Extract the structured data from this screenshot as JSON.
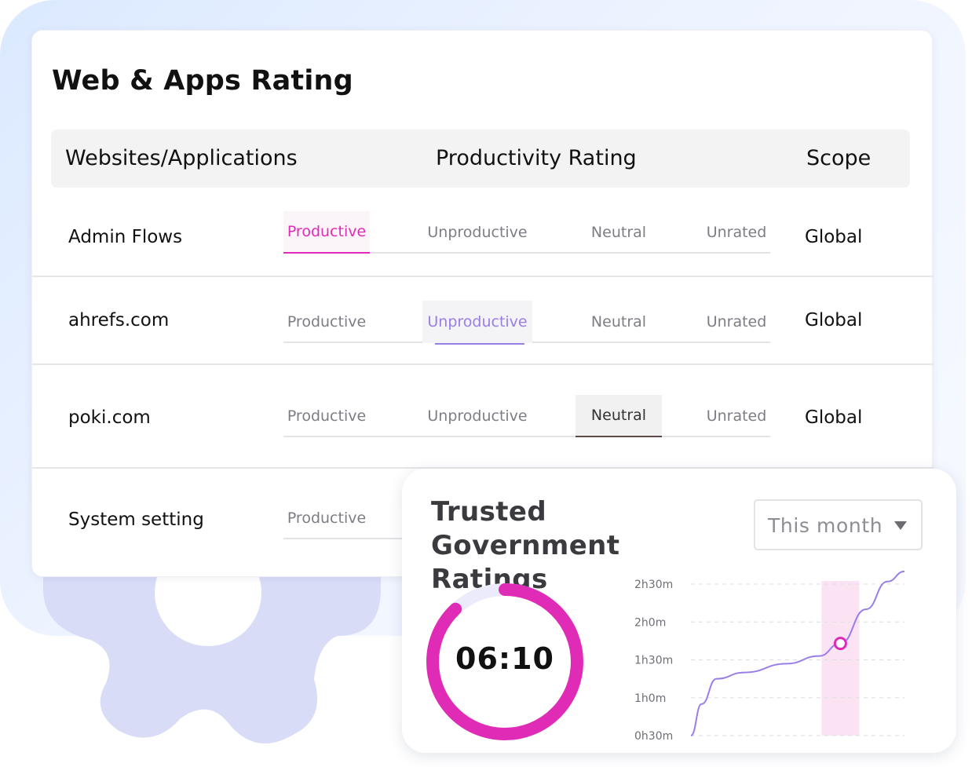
{
  "rating_card": {
    "title": "Web & Apps Rating",
    "columns": {
      "sites": "Websites/Applications",
      "rating": "Productivity Rating",
      "scope": "Scope"
    },
    "rating_options": [
      "Productive",
      "Unproductive",
      "Neutral",
      "Unrated"
    ],
    "rows": [
      {
        "name": "Admin Flows",
        "selected": "Productive",
        "scope": "Global"
      },
      {
        "name": "ahrefs.com",
        "selected": "Unproductive",
        "scope": "Global"
      },
      {
        "name": "poki.com",
        "selected": "Neutral",
        "scope": "Global"
      },
      {
        "name": "System setting",
        "selected": "",
        "scope": ""
      }
    ]
  },
  "trusted_card": {
    "title": "Trusted Government Ratings",
    "period_select": "This month",
    "timer_value": "06:10",
    "progress_fraction": 0.88,
    "colors": {
      "progress": "#e02bb6",
      "track": "#ecebfb",
      "line": "#9a7ee8",
      "highlight": "#fbe3f3"
    }
  },
  "chart_data": {
    "type": "line",
    "y_ticks": [
      "2h30m",
      "2h0m",
      "1h30m",
      "1h0m",
      "0h30m"
    ],
    "points_minutes": [
      [
        0,
        30
      ],
      [
        0.05,
        55
      ],
      [
        0.12,
        75
      ],
      [
        0.25,
        80
      ],
      [
        0.45,
        87
      ],
      [
        0.6,
        93
      ],
      [
        0.7,
        103
      ],
      [
        0.82,
        130
      ],
      [
        0.92,
        152
      ],
      [
        1.0,
        160
      ]
    ],
    "highlight_x": 0.7,
    "ylim_minutes": [
      30,
      150
    ]
  }
}
